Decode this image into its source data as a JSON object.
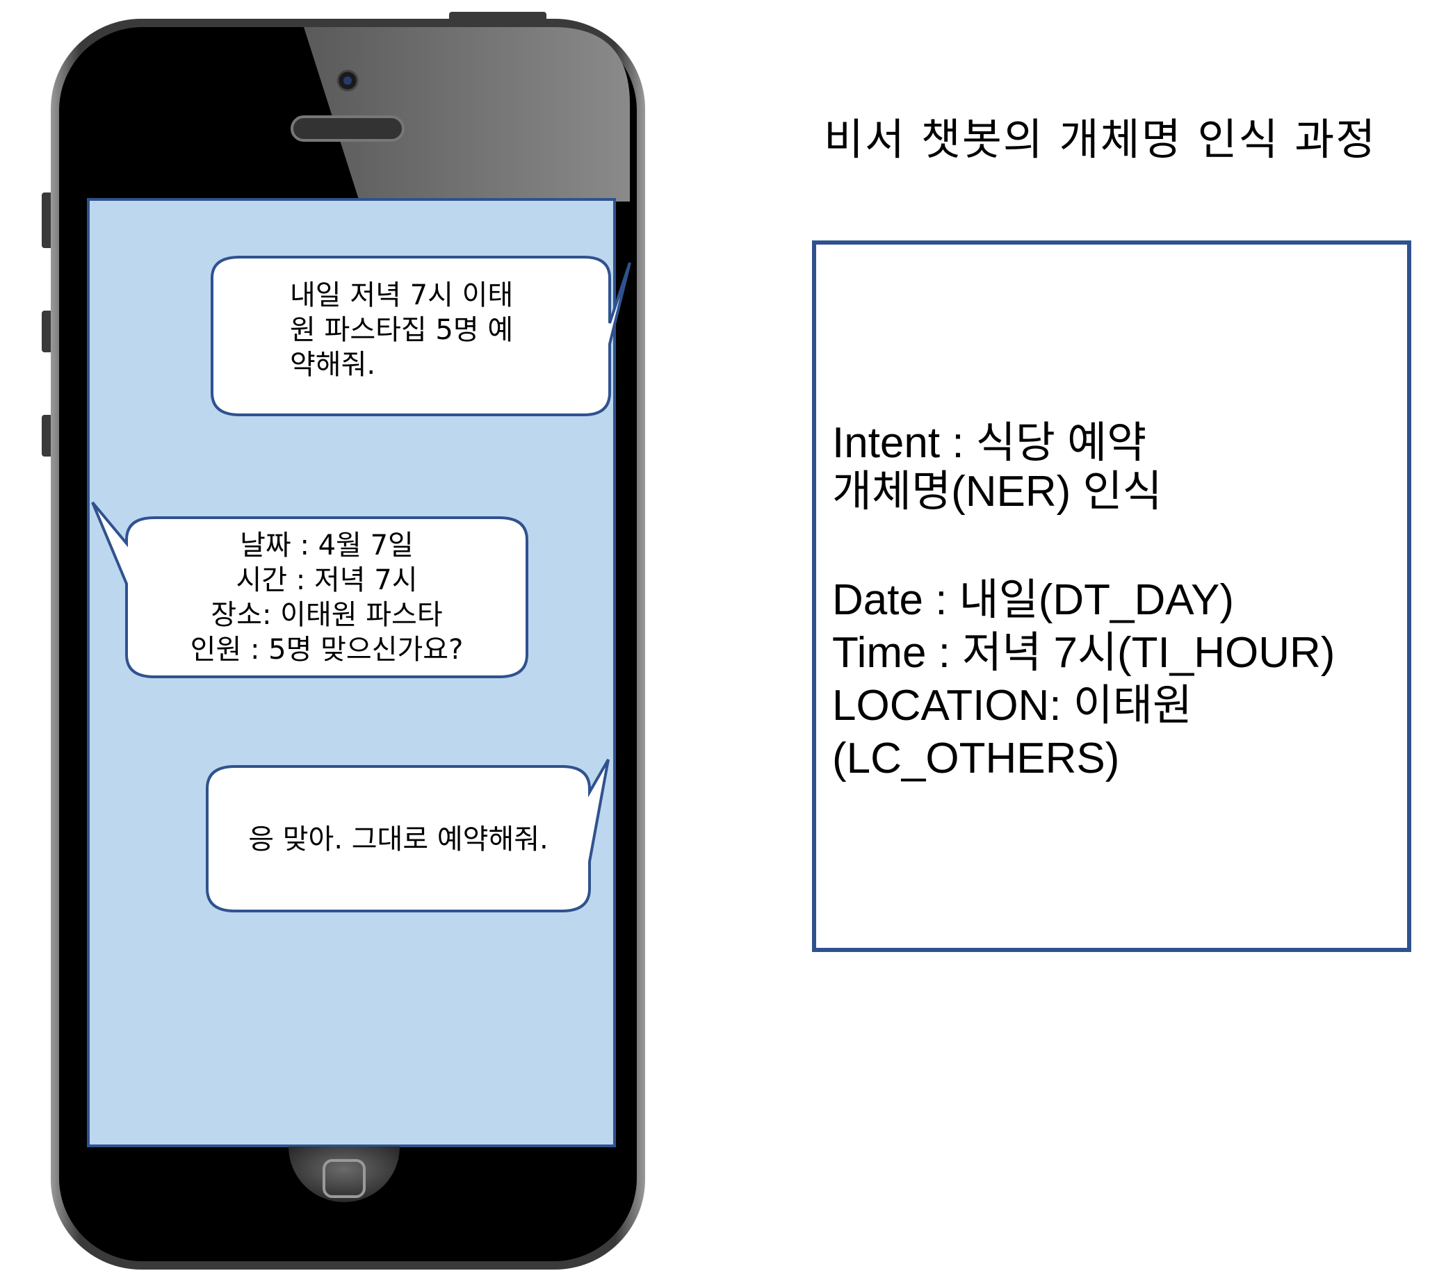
{
  "title": "비서 챗봇의 개체명 인식 과정",
  "chat": {
    "messages": [
      {
        "sender": "user",
        "text": "내일 저녁 7시 이태\n원 파스타집 5명 예\n약해줘."
      },
      {
        "sender": "bot",
        "text": "날짜 : 4월 7일\n시간 : 저녁 7시\n장소: 이태원 파스타\n인원 : 5명 맞으신가요?"
      },
      {
        "sender": "user",
        "text": "응 맞아. 그대로 예약해줘."
      }
    ]
  },
  "analysis": {
    "intent": "Intent : 식당 예약",
    "ner_heading": "개체명(NER) 인식",
    "date": "Date : 내일(DT_DAY)",
    "time": "Time : 저녁 7시(TI_HOUR)",
    "location": "LOCATION: 이태원",
    "location_tag": "(LC_OTHERS)"
  },
  "colors": {
    "screen": "#bdd7ee",
    "outline": "#2f528f",
    "phone_body": "#000000",
    "bubble": "#ffffff"
  }
}
